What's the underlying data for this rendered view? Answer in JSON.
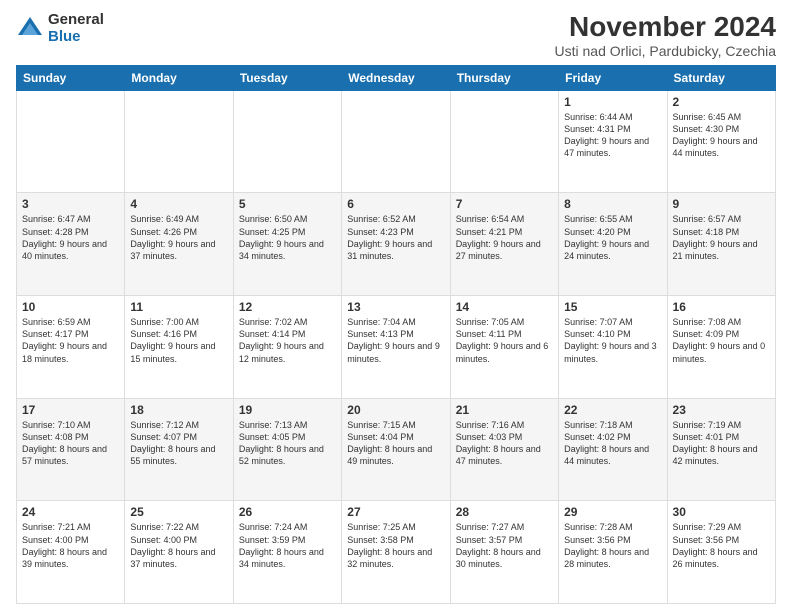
{
  "header": {
    "logo_general": "General",
    "logo_blue": "Blue",
    "month_title": "November 2024",
    "location": "Usti nad Orlici, Pardubicky, Czechia"
  },
  "days_of_week": [
    "Sunday",
    "Monday",
    "Tuesday",
    "Wednesday",
    "Thursday",
    "Friday",
    "Saturday"
  ],
  "weeks": [
    [
      {
        "day": "",
        "info": ""
      },
      {
        "day": "",
        "info": ""
      },
      {
        "day": "",
        "info": ""
      },
      {
        "day": "",
        "info": ""
      },
      {
        "day": "",
        "info": ""
      },
      {
        "day": "1",
        "info": "Sunrise: 6:44 AM\nSunset: 4:31 PM\nDaylight: 9 hours\nand 47 minutes."
      },
      {
        "day": "2",
        "info": "Sunrise: 6:45 AM\nSunset: 4:30 PM\nDaylight: 9 hours\nand 44 minutes."
      }
    ],
    [
      {
        "day": "3",
        "info": "Sunrise: 6:47 AM\nSunset: 4:28 PM\nDaylight: 9 hours\nand 40 minutes."
      },
      {
        "day": "4",
        "info": "Sunrise: 6:49 AM\nSunset: 4:26 PM\nDaylight: 9 hours\nand 37 minutes."
      },
      {
        "day": "5",
        "info": "Sunrise: 6:50 AM\nSunset: 4:25 PM\nDaylight: 9 hours\nand 34 minutes."
      },
      {
        "day": "6",
        "info": "Sunrise: 6:52 AM\nSunset: 4:23 PM\nDaylight: 9 hours\nand 31 minutes."
      },
      {
        "day": "7",
        "info": "Sunrise: 6:54 AM\nSunset: 4:21 PM\nDaylight: 9 hours\nand 27 minutes."
      },
      {
        "day": "8",
        "info": "Sunrise: 6:55 AM\nSunset: 4:20 PM\nDaylight: 9 hours\nand 24 minutes."
      },
      {
        "day": "9",
        "info": "Sunrise: 6:57 AM\nSunset: 4:18 PM\nDaylight: 9 hours\nand 21 minutes."
      }
    ],
    [
      {
        "day": "10",
        "info": "Sunrise: 6:59 AM\nSunset: 4:17 PM\nDaylight: 9 hours\nand 18 minutes."
      },
      {
        "day": "11",
        "info": "Sunrise: 7:00 AM\nSunset: 4:16 PM\nDaylight: 9 hours\nand 15 minutes."
      },
      {
        "day": "12",
        "info": "Sunrise: 7:02 AM\nSunset: 4:14 PM\nDaylight: 9 hours\nand 12 minutes."
      },
      {
        "day": "13",
        "info": "Sunrise: 7:04 AM\nSunset: 4:13 PM\nDaylight: 9 hours\nand 9 minutes."
      },
      {
        "day": "14",
        "info": "Sunrise: 7:05 AM\nSunset: 4:11 PM\nDaylight: 9 hours\nand 6 minutes."
      },
      {
        "day": "15",
        "info": "Sunrise: 7:07 AM\nSunset: 4:10 PM\nDaylight: 9 hours\nand 3 minutes."
      },
      {
        "day": "16",
        "info": "Sunrise: 7:08 AM\nSunset: 4:09 PM\nDaylight: 9 hours\nand 0 minutes."
      }
    ],
    [
      {
        "day": "17",
        "info": "Sunrise: 7:10 AM\nSunset: 4:08 PM\nDaylight: 8 hours\nand 57 minutes."
      },
      {
        "day": "18",
        "info": "Sunrise: 7:12 AM\nSunset: 4:07 PM\nDaylight: 8 hours\nand 55 minutes."
      },
      {
        "day": "19",
        "info": "Sunrise: 7:13 AM\nSunset: 4:05 PM\nDaylight: 8 hours\nand 52 minutes."
      },
      {
        "day": "20",
        "info": "Sunrise: 7:15 AM\nSunset: 4:04 PM\nDaylight: 8 hours\nand 49 minutes."
      },
      {
        "day": "21",
        "info": "Sunrise: 7:16 AM\nSunset: 4:03 PM\nDaylight: 8 hours\nand 47 minutes."
      },
      {
        "day": "22",
        "info": "Sunrise: 7:18 AM\nSunset: 4:02 PM\nDaylight: 8 hours\nand 44 minutes."
      },
      {
        "day": "23",
        "info": "Sunrise: 7:19 AM\nSunset: 4:01 PM\nDaylight: 8 hours\nand 42 minutes."
      }
    ],
    [
      {
        "day": "24",
        "info": "Sunrise: 7:21 AM\nSunset: 4:00 PM\nDaylight: 8 hours\nand 39 minutes."
      },
      {
        "day": "25",
        "info": "Sunrise: 7:22 AM\nSunset: 4:00 PM\nDaylight: 8 hours\nand 37 minutes."
      },
      {
        "day": "26",
        "info": "Sunrise: 7:24 AM\nSunset: 3:59 PM\nDaylight: 8 hours\nand 34 minutes."
      },
      {
        "day": "27",
        "info": "Sunrise: 7:25 AM\nSunset: 3:58 PM\nDaylight: 8 hours\nand 32 minutes."
      },
      {
        "day": "28",
        "info": "Sunrise: 7:27 AM\nSunset: 3:57 PM\nDaylight: 8 hours\nand 30 minutes."
      },
      {
        "day": "29",
        "info": "Sunrise: 7:28 AM\nSunset: 3:56 PM\nDaylight: 8 hours\nand 28 minutes."
      },
      {
        "day": "30",
        "info": "Sunrise: 7:29 AM\nSunset: 3:56 PM\nDaylight: 8 hours\nand 26 minutes."
      }
    ]
  ]
}
